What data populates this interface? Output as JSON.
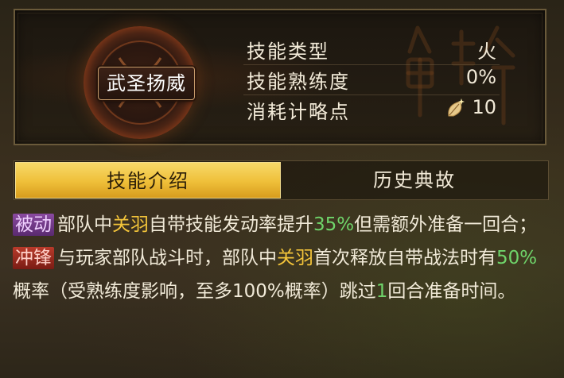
{
  "skill": {
    "name": "武圣扬威",
    "stats": [
      {
        "label": "技能类型",
        "value": "火"
      },
      {
        "label": "技能熟练度",
        "value": "0%"
      },
      {
        "label": "消耗计略点",
        "value": "10",
        "icon": "leaf-icon"
      }
    ]
  },
  "tabs": {
    "intro": "技能介绍",
    "history": "历史典故",
    "active": "intro"
  },
  "description": {
    "line1": {
      "tag": "被动",
      "p1": "部队中",
      "hero": "关羽",
      "p2": "自带技能发动率提升",
      "pct": "35%",
      "p3": "但需额外准备一回合；"
    },
    "line2": {
      "tag": "冲锋",
      "p1": "与玩家部队战斗时，部队中",
      "hero": "关羽",
      "p2": "首次释放自带战法时有",
      "pct": "50%",
      "p3": "概率（受熟练度影响，至多100%概率）跳过",
      "rounds": "1",
      "p4": "回合准备时间。"
    }
  },
  "colors": {
    "gold_highlight": "#f3c43a",
    "green_highlight": "#6fd46a",
    "tab_active": "#efbf39",
    "tag_passive": "#8a4aa0",
    "tag_charge": "#b83a2a"
  }
}
